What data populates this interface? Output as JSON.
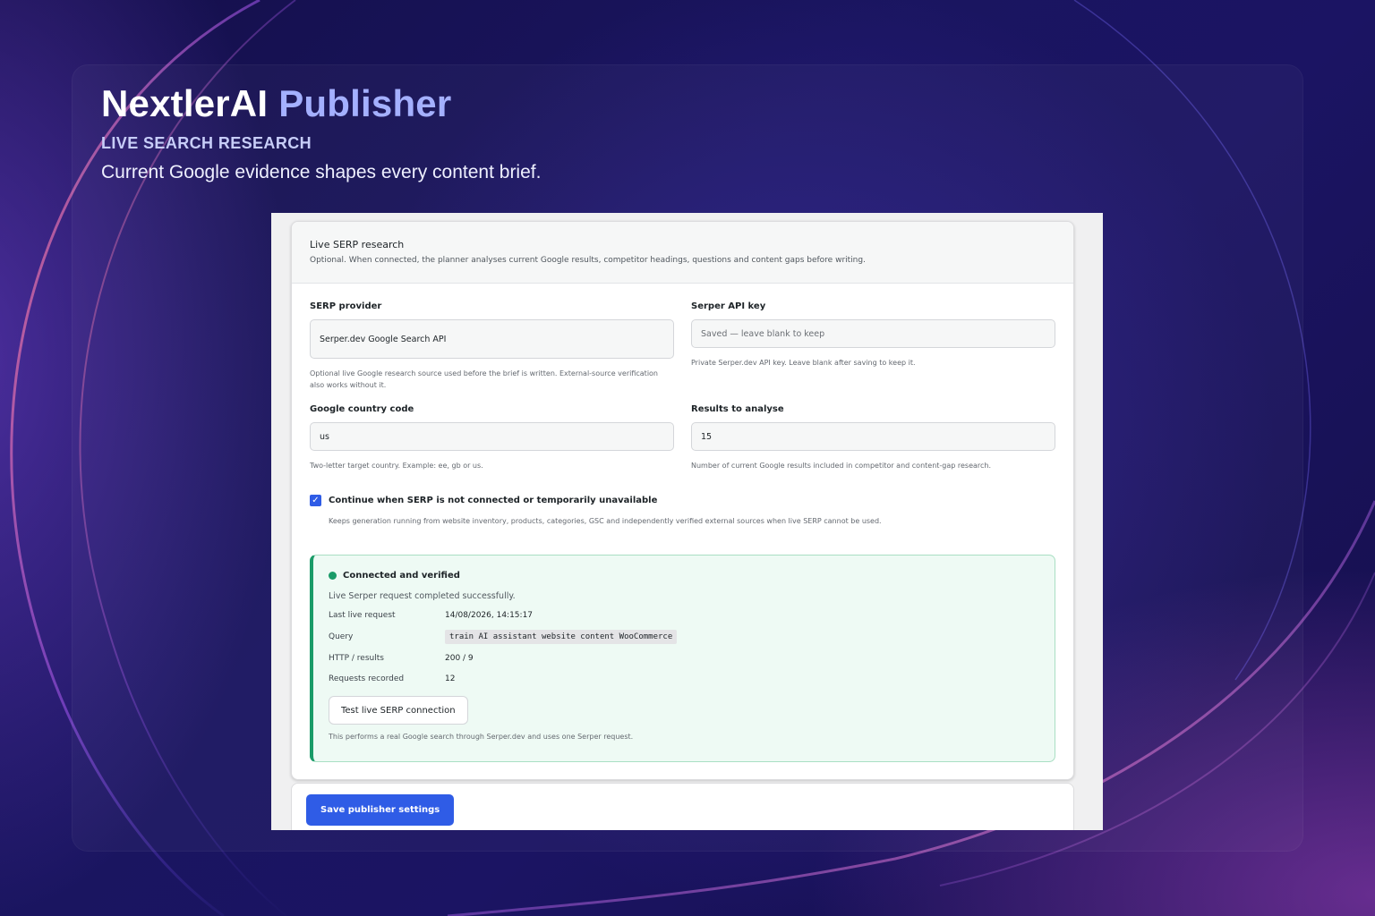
{
  "hero": {
    "brand": "NextlerAI",
    "product": "Publisher",
    "eyebrow": "LIVE SEARCH RESEARCH",
    "subtitle": "Current Google evidence shapes every content brief."
  },
  "card": {
    "title": "Live SERP research",
    "description": "Optional. When connected, the planner analyses current Google results, competitor headings, questions and content gaps before writing."
  },
  "fields": {
    "provider": {
      "label": "SERP provider",
      "value": "Serper.dev Google Search API",
      "help": "Optional live Google research source used before the brief is written. External-source verification also works without it."
    },
    "api_key": {
      "label": "Serper API key",
      "placeholder": "Saved — leave blank to keep",
      "help": "Private Serper.dev API key. Leave blank after saving to keep it."
    },
    "country": {
      "label": "Google country code",
      "value": "us",
      "help": "Two-letter target country. Example: ee, gb or us."
    },
    "results": {
      "label": "Results to analyse",
      "value": "15",
      "help": "Number of current Google results included in competitor and content-gap research."
    }
  },
  "fallback": {
    "checked": true,
    "label": "Continue when SERP is not connected or temporarily unavailable",
    "help": "Keeps generation running from website inventory, products, categories, GSC and independently verified external sources when live SERP cannot be used."
  },
  "status": {
    "title": "Connected and verified",
    "message": "Live Serper request completed successfully.",
    "rows": [
      {
        "key": "Last live request",
        "value": "14/08/2026, 14:15:17"
      },
      {
        "key": "Query",
        "value": "train AI assistant website content WooCommerce"
      },
      {
        "key": "HTTP / results",
        "value": "200 / 9"
      },
      {
        "key": "Requests recorded",
        "value": "12"
      }
    ],
    "test_button": "Test live SERP connection",
    "footnote": "This performs a real Google search through Serper.dev and uses one Serper request.",
    "color": "#1a9b68"
  },
  "actions": {
    "save": "Save publisher settings",
    "accent": "#2f5ce6"
  }
}
